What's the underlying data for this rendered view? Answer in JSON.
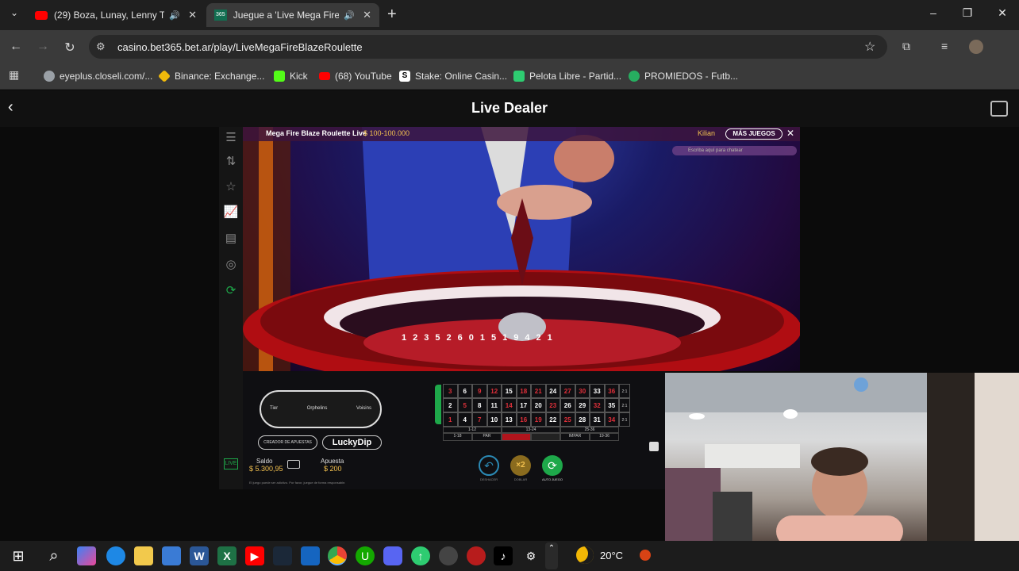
{
  "browser": {
    "tabs": [
      {
        "title": "(29) Boza, Lunay, Lenny Tav",
        "active": false
      },
      {
        "title": "Juegue a 'Live Mega Fire Bl",
        "active": true
      }
    ],
    "new_tab": "+",
    "window_controls": {
      "minimize": "–",
      "restore": "❐",
      "close": "✕"
    },
    "url": "casino.bet365.bet.ar/play/LiveMegaFireBlazeRoulette",
    "bookmarks": [
      {
        "label": "eyeplus.closeli.com/...",
        "icon_color": "#9aa0a6"
      },
      {
        "label": "Binance: Exchange...",
        "icon_color": "#f0b90b"
      },
      {
        "label": "Kick",
        "icon_color": "#53fc18"
      },
      {
        "label": "(68) YouTube",
        "icon_color": "#ff0000"
      },
      {
        "label": "Stake: Online Casin...",
        "icon_color": "#ffffff"
      },
      {
        "label": "Pelota Libre - Partid...",
        "icon_color": "#2ecc71"
      },
      {
        "label": "PROMIEDOS - Futb...",
        "icon_color": "#27ae60"
      }
    ]
  },
  "page": {
    "title": "Live Dealer"
  },
  "game": {
    "table_name": "Mega Fire Blaze Roulette Live",
    "limits": "$ 100-100.000",
    "player_name": "Kilian",
    "more_games": "MÁS JUEGOS",
    "chat_placeholder": "Escriba aquí para chatear",
    "racetrack": {
      "left": "Tier",
      "middle": "Orphelins",
      "right": "Voisins"
    },
    "creator_button": "CREADOR DE APUESTAS",
    "luckydip_button": "LuckyDip",
    "balance_label": "Saldo",
    "balance_value": "$ 5.300,95",
    "bet_label": "Apuesta",
    "bet_value": "$ 200",
    "disclaimer": "El juego puede ser adictivo. Por favor, juegue de forma responsable.",
    "controls": {
      "undo": "DESHACER",
      "double": "DOBLAR",
      "autoplay": "AUTO JUEGO"
    },
    "double_label": "×2",
    "grid_rows": [
      [
        "3",
        "6",
        "9",
        "12",
        "15",
        "18",
        "21",
        "24",
        "27",
        "30",
        "33",
        "36"
      ],
      [
        "2",
        "5",
        "8",
        "11",
        "14",
        "17",
        "20",
        "23",
        "26",
        "29",
        "32",
        "35"
      ],
      [
        "1",
        "4",
        "7",
        "10",
        "13",
        "16",
        "19",
        "22",
        "25",
        "28",
        "31",
        "34"
      ]
    ],
    "red_numbers": [
      "1",
      "3",
      "5",
      "7",
      "9",
      "12",
      "14",
      "16",
      "18",
      "19",
      "21",
      "23",
      "25",
      "27",
      "30",
      "32",
      "34",
      "36"
    ],
    "column_bet": "2:1",
    "dozens": [
      "1-12",
      "13-24",
      "25-36"
    ],
    "outside_bets": [
      "1-18",
      "PAR",
      "",
      "",
      "IMPAR",
      "19-36"
    ],
    "wheel_numbers": [
      "12",
      "35",
      "3",
      "26",
      "0",
      "32",
      "15",
      "19",
      "4",
      "21",
      "2"
    ]
  },
  "taskbar": {
    "weather": "20°C",
    "icons": [
      "windows-start",
      "search",
      "copilot",
      "edge",
      "file-explorer",
      "store",
      "word",
      "excel",
      "youtube",
      "steam",
      "shield",
      "chrome",
      "upwork",
      "discord",
      "cloud",
      "cursor",
      "app-red",
      "tiktok",
      "settings"
    ]
  },
  "colors": {
    "accent_green": "#1ea84a",
    "roulette_red": "#c0141c",
    "chrome_dark": "#1f1f1f"
  }
}
